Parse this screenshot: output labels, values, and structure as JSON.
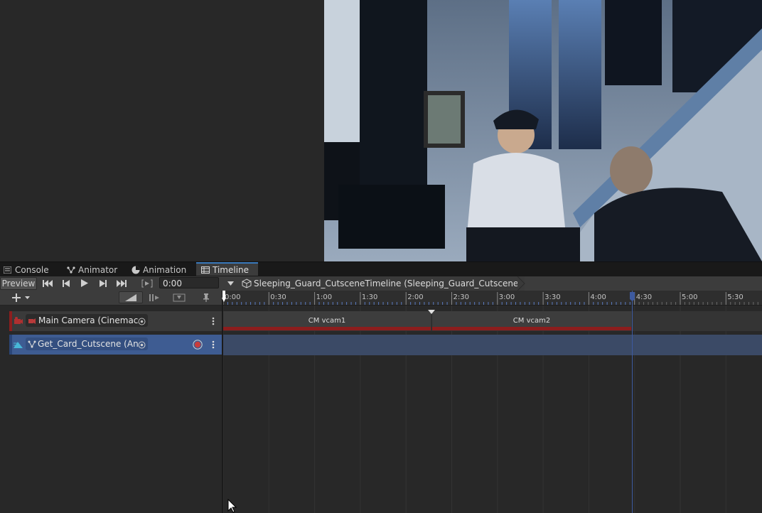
{
  "tabs": [
    {
      "label": "Console",
      "icon": "console-icon"
    },
    {
      "label": "Animator",
      "icon": "animator-icon"
    },
    {
      "label": "Animation",
      "icon": "animation-icon"
    },
    {
      "label": "Timeline",
      "icon": "timeline-icon",
      "active": true
    }
  ],
  "toolbar": {
    "preview_label": "Preview",
    "time_value": "0:00",
    "timeline_asset": "Sleeping_Guard_CutsceneTimeline (Sleeping_Guard_Cutscene)"
  },
  "ruler": {
    "labels": [
      "0:00",
      "0:30",
      "1:00",
      "1:30",
      "2:00",
      "2:30",
      "3:00",
      "3:30",
      "4:00",
      "4:30",
      "5:00",
      "5:30"
    ],
    "end_marker": "4:30"
  },
  "tracks": [
    {
      "binding": "Main Camera (Cinemac",
      "type": "cinemachine"
    },
    {
      "binding": "Get_Card_Cutscene (An",
      "type": "animation"
    }
  ],
  "clips": [
    {
      "label": "CM vcam1",
      "start": "0:00",
      "end": "2:15"
    },
    {
      "label": "CM vcam2",
      "start": "2:15",
      "end": "4:28"
    }
  ],
  "colors": {
    "accent": "#3a79bb",
    "camera_track": "#8c1e1e",
    "anim_track": "#3e5c92",
    "record": "#c83c3c"
  }
}
